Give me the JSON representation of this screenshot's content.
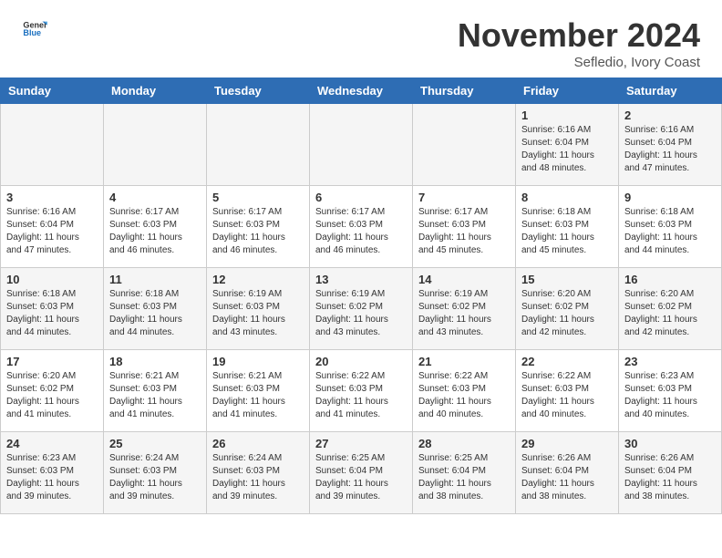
{
  "header": {
    "logo_general": "General",
    "logo_blue": "Blue",
    "month_title": "November 2024",
    "location": "Sefledio, Ivory Coast"
  },
  "days_of_week": [
    "Sunday",
    "Monday",
    "Tuesday",
    "Wednesday",
    "Thursday",
    "Friday",
    "Saturday"
  ],
  "weeks": [
    [
      {
        "day": "",
        "info": ""
      },
      {
        "day": "",
        "info": ""
      },
      {
        "day": "",
        "info": ""
      },
      {
        "day": "",
        "info": ""
      },
      {
        "day": "",
        "info": ""
      },
      {
        "day": "1",
        "info": "Sunrise: 6:16 AM\nSunset: 6:04 PM\nDaylight: 11 hours\nand 48 minutes."
      },
      {
        "day": "2",
        "info": "Sunrise: 6:16 AM\nSunset: 6:04 PM\nDaylight: 11 hours\nand 47 minutes."
      }
    ],
    [
      {
        "day": "3",
        "info": "Sunrise: 6:16 AM\nSunset: 6:04 PM\nDaylight: 11 hours\nand 47 minutes."
      },
      {
        "day": "4",
        "info": "Sunrise: 6:17 AM\nSunset: 6:03 PM\nDaylight: 11 hours\nand 46 minutes."
      },
      {
        "day": "5",
        "info": "Sunrise: 6:17 AM\nSunset: 6:03 PM\nDaylight: 11 hours\nand 46 minutes."
      },
      {
        "day": "6",
        "info": "Sunrise: 6:17 AM\nSunset: 6:03 PM\nDaylight: 11 hours\nand 46 minutes."
      },
      {
        "day": "7",
        "info": "Sunrise: 6:17 AM\nSunset: 6:03 PM\nDaylight: 11 hours\nand 45 minutes."
      },
      {
        "day": "8",
        "info": "Sunrise: 6:18 AM\nSunset: 6:03 PM\nDaylight: 11 hours\nand 45 minutes."
      },
      {
        "day": "9",
        "info": "Sunrise: 6:18 AM\nSunset: 6:03 PM\nDaylight: 11 hours\nand 44 minutes."
      }
    ],
    [
      {
        "day": "10",
        "info": "Sunrise: 6:18 AM\nSunset: 6:03 PM\nDaylight: 11 hours\nand 44 minutes."
      },
      {
        "day": "11",
        "info": "Sunrise: 6:18 AM\nSunset: 6:03 PM\nDaylight: 11 hours\nand 44 minutes."
      },
      {
        "day": "12",
        "info": "Sunrise: 6:19 AM\nSunset: 6:03 PM\nDaylight: 11 hours\nand 43 minutes."
      },
      {
        "day": "13",
        "info": "Sunrise: 6:19 AM\nSunset: 6:02 PM\nDaylight: 11 hours\nand 43 minutes."
      },
      {
        "day": "14",
        "info": "Sunrise: 6:19 AM\nSunset: 6:02 PM\nDaylight: 11 hours\nand 43 minutes."
      },
      {
        "day": "15",
        "info": "Sunrise: 6:20 AM\nSunset: 6:02 PM\nDaylight: 11 hours\nand 42 minutes."
      },
      {
        "day": "16",
        "info": "Sunrise: 6:20 AM\nSunset: 6:02 PM\nDaylight: 11 hours\nand 42 minutes."
      }
    ],
    [
      {
        "day": "17",
        "info": "Sunrise: 6:20 AM\nSunset: 6:02 PM\nDaylight: 11 hours\nand 41 minutes."
      },
      {
        "day": "18",
        "info": "Sunrise: 6:21 AM\nSunset: 6:03 PM\nDaylight: 11 hours\nand 41 minutes."
      },
      {
        "day": "19",
        "info": "Sunrise: 6:21 AM\nSunset: 6:03 PM\nDaylight: 11 hours\nand 41 minutes."
      },
      {
        "day": "20",
        "info": "Sunrise: 6:22 AM\nSunset: 6:03 PM\nDaylight: 11 hours\nand 41 minutes."
      },
      {
        "day": "21",
        "info": "Sunrise: 6:22 AM\nSunset: 6:03 PM\nDaylight: 11 hours\nand 40 minutes."
      },
      {
        "day": "22",
        "info": "Sunrise: 6:22 AM\nSunset: 6:03 PM\nDaylight: 11 hours\nand 40 minutes."
      },
      {
        "day": "23",
        "info": "Sunrise: 6:23 AM\nSunset: 6:03 PM\nDaylight: 11 hours\nand 40 minutes."
      }
    ],
    [
      {
        "day": "24",
        "info": "Sunrise: 6:23 AM\nSunset: 6:03 PM\nDaylight: 11 hours\nand 39 minutes."
      },
      {
        "day": "25",
        "info": "Sunrise: 6:24 AM\nSunset: 6:03 PM\nDaylight: 11 hours\nand 39 minutes."
      },
      {
        "day": "26",
        "info": "Sunrise: 6:24 AM\nSunset: 6:03 PM\nDaylight: 11 hours\nand 39 minutes."
      },
      {
        "day": "27",
        "info": "Sunrise: 6:25 AM\nSunset: 6:04 PM\nDaylight: 11 hours\nand 39 minutes."
      },
      {
        "day": "28",
        "info": "Sunrise: 6:25 AM\nSunset: 6:04 PM\nDaylight: 11 hours\nand 38 minutes."
      },
      {
        "day": "29",
        "info": "Sunrise: 6:26 AM\nSunset: 6:04 PM\nDaylight: 11 hours\nand 38 minutes."
      },
      {
        "day": "30",
        "info": "Sunrise: 6:26 AM\nSunset: 6:04 PM\nDaylight: 11 hours\nand 38 minutes."
      }
    ]
  ]
}
